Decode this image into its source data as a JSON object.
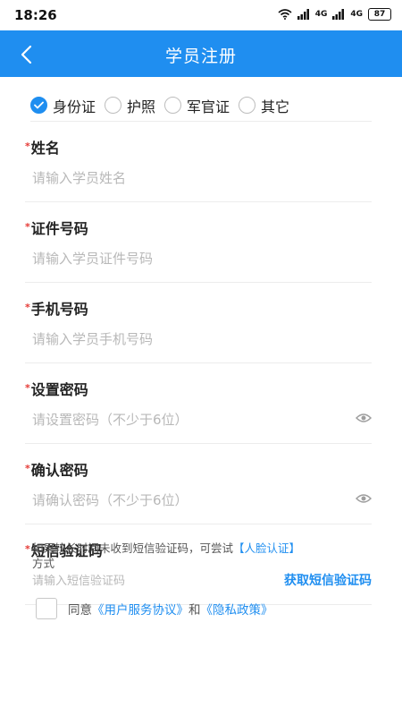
{
  "status_bar": {
    "time": "18:26",
    "signal1": "4G",
    "signal2": "4G",
    "battery": "87"
  },
  "app_bar": {
    "title": "学员注册"
  },
  "id_types": [
    {
      "label": "身份证",
      "checked": true
    },
    {
      "label": "护照",
      "checked": false
    },
    {
      "label": "军官证",
      "checked": false
    },
    {
      "label": "其它",
      "checked": false
    }
  ],
  "fields": {
    "required_mark": "*",
    "name": {
      "label": "姓名",
      "placeholder": "请输入学员姓名"
    },
    "id_number": {
      "label": "证件号码",
      "placeholder": "请输入学员证件号码"
    },
    "phone": {
      "label": "手机号码",
      "placeholder": "请输入学员手机号码"
    },
    "password": {
      "label": "设置密码",
      "placeholder": "请设置密码（不少于6位）"
    },
    "confirm_password": {
      "label": "确认密码",
      "placeholder": "请确认密码（不少于6位）"
    },
    "sms_code": {
      "label": "短信验证码",
      "placeholder": "请输入短信验证码",
      "button": "获取短信验证码"
    }
  },
  "hint": {
    "prefix": "如果较长时间未收到短信验证码，可尝试",
    "link": "【人脸认证】",
    "suffix": "方式"
  },
  "agreement": {
    "prefix": "同意",
    "terms": "《用户服务协议》",
    "and": "和",
    "privacy": "《隐私政策》"
  },
  "colors": {
    "primary": "#1f8ef0",
    "required": "#e53935"
  }
}
